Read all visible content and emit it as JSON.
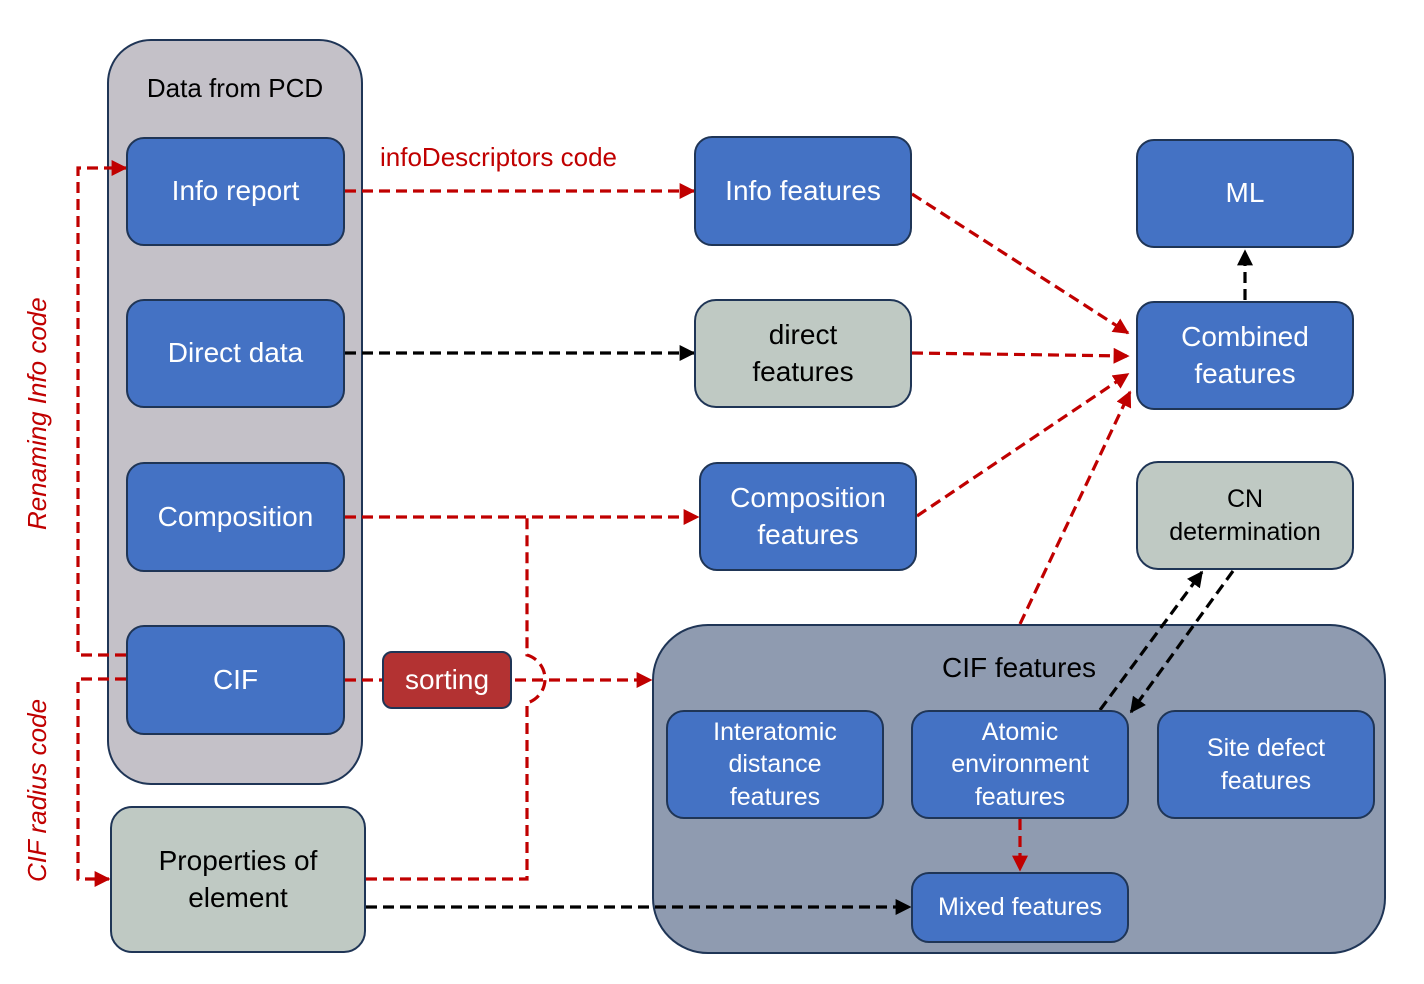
{
  "colors": {
    "node_blue": "#4472c4",
    "node_sage": "#bfc9c3",
    "group_pcd": "#c4c1c8",
    "group_cif": "#8f9bb0",
    "sorting": "#b33232",
    "edge_red": "#c00000",
    "edge_black": "#000000",
    "border": "#1f3556"
  },
  "groups": {
    "pcd": {
      "label": "Data from PCD"
    },
    "cif": {
      "label": "CIF features"
    }
  },
  "nodes": {
    "info_report": "Info report",
    "direct_data": "Direct data",
    "composition": "Composition",
    "cif": "CIF",
    "properties_of_element": "Properties of element",
    "info_features": "Info features",
    "direct_features": "direct features",
    "composition_features": "Composition features",
    "combined_features": "Combined features",
    "ml": "ML",
    "cn_determination": "CN determination",
    "interatomic_distance_features": "Interatomic distance features",
    "atomic_environment_features": "Atomic environment features",
    "site_defect_features": "Site defect features",
    "mixed_features": "Mixed features",
    "sorting": "sorting"
  },
  "edge_labels": {
    "info_descriptors_code": "infoDescriptors code",
    "renaming_info_code": "Renaming Info code",
    "cif_radius_code": "CIF radius code"
  },
  "edges": [
    {
      "from": "info_report",
      "to": "info_features",
      "style": "red-dashed",
      "label": "infoDescriptors code"
    },
    {
      "from": "direct_data",
      "to": "direct_features",
      "style": "black-dashed"
    },
    {
      "from": "composition",
      "to": "composition_features",
      "style": "red-dashed"
    },
    {
      "from": "properties_of_element",
      "to": "composition_features",
      "style": "red-dashed"
    },
    {
      "from": "cif",
      "to": "cif_features",
      "style": "red-dashed",
      "via": "sorting"
    },
    {
      "from": "cif",
      "to": "info_report",
      "style": "red-dashed",
      "label": "Renaming Info code"
    },
    {
      "from": "cif",
      "to": "properties_of_element",
      "style": "red-dashed",
      "label": "CIF radius code"
    },
    {
      "from": "properties_of_element",
      "to": "mixed_features",
      "style": "black-dashed"
    },
    {
      "from": "info_features",
      "to": "combined_features",
      "style": "red-dashed"
    },
    {
      "from": "direct_features",
      "to": "combined_features",
      "style": "red-dashed"
    },
    {
      "from": "composition_features",
      "to": "combined_features",
      "style": "red-dashed"
    },
    {
      "from": "cif_features",
      "to": "combined_features",
      "style": "red-dashed"
    },
    {
      "from": "combined_features",
      "to": "ml",
      "style": "black-dashed"
    },
    {
      "from": "atomic_environment_features",
      "to": "cn_determination",
      "style": "black-dashed"
    },
    {
      "from": "cn_determination",
      "to": "atomic_environment_features",
      "style": "black-dashed"
    },
    {
      "from": "atomic_environment_features",
      "to": "mixed_features",
      "style": "red-dashed"
    }
  ]
}
